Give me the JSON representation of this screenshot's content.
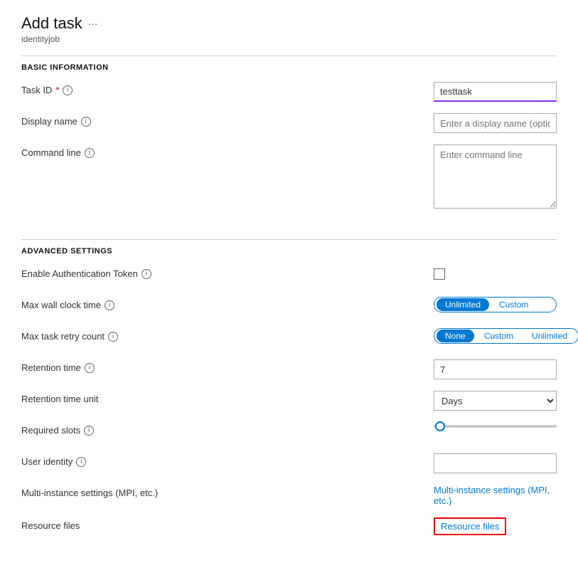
{
  "page": {
    "title": "Add task",
    "ellipsis": "···",
    "subtitle": "identityjob"
  },
  "sections": {
    "basic": {
      "header": "BASIC INFORMATION",
      "task_id_label": "Task ID",
      "task_id_required": "*",
      "task_id_value": "testtask",
      "display_name_label": "Display name",
      "display_name_placeholder": "Enter a display name (optional)",
      "command_line_label": "Command line",
      "command_line_placeholder": "Enter command line"
    },
    "advanced": {
      "header": "ADVANCED SETTINGS",
      "auth_token_label": "Enable Authentication Token",
      "max_wall_clock_label": "Max wall clock time",
      "max_wall_clock_options": [
        "Unlimited",
        "Custom"
      ],
      "max_wall_clock_selected": "Unlimited",
      "max_retry_label": "Max task retry count",
      "max_retry_options": [
        "None",
        "Custom",
        "Unlimited"
      ],
      "max_retry_selected": "None",
      "retention_time_label": "Retention time",
      "retention_time_value": "7",
      "retention_time_unit_label": "Retention time unit",
      "retention_time_unit_value": "Days",
      "required_slots_label": "Required slots",
      "user_identity_label": "User identity",
      "user_identity_value": "",
      "mpi_label": "Multi-instance settings (MPI, etc.)",
      "mpi_link_text": "Multi-instance settings (MPI, etc.)",
      "resource_files_label": "Resource files",
      "resource_files_link": "Resource files"
    }
  },
  "icons": {
    "info": "i",
    "ellipsis": "···"
  }
}
